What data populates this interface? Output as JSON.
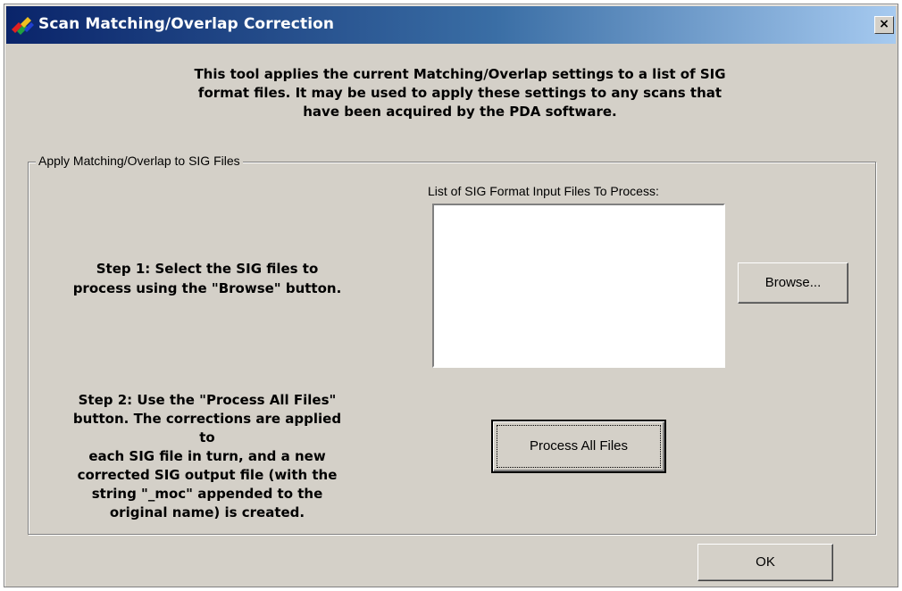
{
  "window": {
    "title": "Scan Matching/Overlap Correction",
    "title_icon": "app-logo-icon",
    "close_label": "×"
  },
  "intro": {
    "line1": "This tool applies the current Matching/Overlap settings to a list of SIG",
    "line2": "format files. It may be used to apply these settings to any scans that",
    "line3": "have been acquired by the PDA software."
  },
  "group": {
    "legend": "Apply Matching/Overlap to SIG Files",
    "list_label": "List of SIG Format Input Files To Process:",
    "file_list_items": [],
    "step1": {
      "line1": "Step 1: Select the SIG files to",
      "line2": "process using the \"Browse\" button."
    },
    "step2": {
      "line1": "Step 2: Use the \"Process All Files\"",
      "line2": "button. The corrections are applied to",
      "line3": "each SIG file in turn, and a new",
      "line4": "corrected SIG output file (with the",
      "line5": "string \"_moc\" appended to the",
      "line6": "original name) is created."
    },
    "browse_label": "Browse...",
    "process_label": "Process All Files"
  },
  "footer": {
    "ok_label": "OK"
  },
  "colors": {
    "dialog_face": "#d4d0c8",
    "titlebar_start": "#0a246a",
    "titlebar_end": "#a6caf0",
    "list_background": "#ffffff"
  }
}
